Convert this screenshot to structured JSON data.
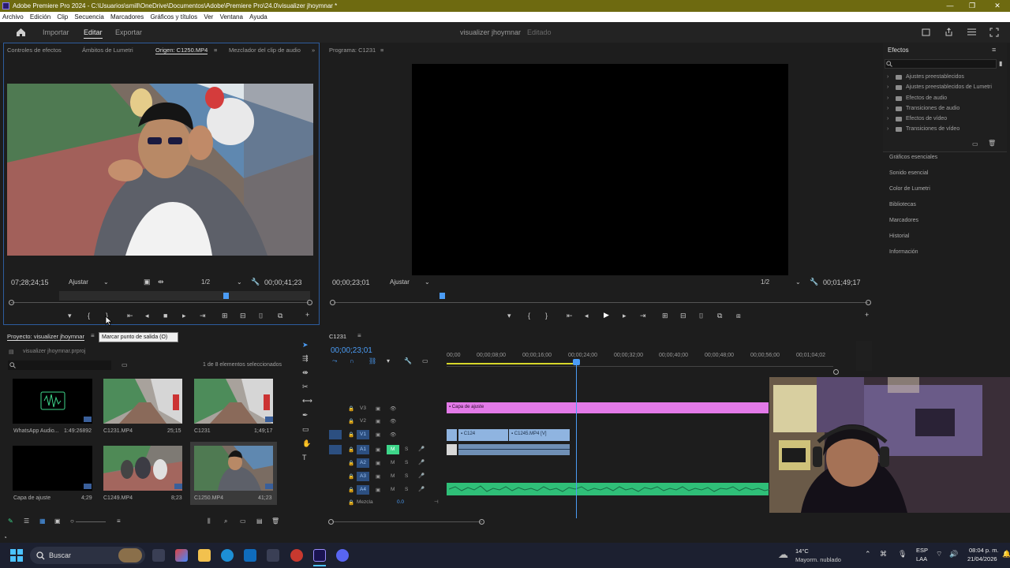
{
  "titlebar": {
    "title": "Adobe Premiere Pro 2024 - C:\\Usuarios\\smill\\OneDrive\\Documentos\\Adobe\\Premiere Pro\\24.0\\visualizer jhoymnar *",
    "minimize": "—",
    "maximize": "❐",
    "close": "✕"
  },
  "menu": [
    "Archivo",
    "Edición",
    "Clip",
    "Secuencia",
    "Marcadores",
    "Gráficos y títulos",
    "Ver",
    "Ventana",
    "Ayuda"
  ],
  "workspace": {
    "tabs": [
      "Importar",
      "Editar",
      "Exportar"
    ],
    "project_title": "visualizer jhoymnar",
    "status": "Editado"
  },
  "source_panel": {
    "tabs": [
      "Controles de efectos",
      "Ámbitos de Lumetri",
      "Origen: C1250.MP4",
      "Mezclador del clip de audio"
    ],
    "timecode": "07;28;24;15",
    "fit": "Ajustar",
    "resolution": "1/2",
    "duration": "00;00;41;23",
    "tooltip": "Marcar punto de salida (O)"
  },
  "program_panel": {
    "tab": "Programa: C1231",
    "timecode": "00;00;23;01",
    "fit": "Ajustar",
    "resolution": "1/2",
    "duration": "00;01;49;17"
  },
  "effects_panel": {
    "title": "Efectos",
    "folders": [
      "Ajustes preestablecidos",
      "Ajustes preestablecidos de Lumetri",
      "Efectos de audio",
      "Transiciones de audio",
      "Efectos de vídeo",
      "Transiciones de vídeo"
    ],
    "sections": [
      "Gráficos esenciales",
      "Sonido esencial",
      "Color de Lumetri",
      "Bibliotecas",
      "Marcadores",
      "Historial",
      "Información"
    ]
  },
  "project_panel": {
    "tab": "Proyecto: visualizer jhoymnar",
    "file": "visualizer jhoymnar.prproj",
    "selection": "1 de 8 elementos seleccionados",
    "items": [
      {
        "name": "WhatsApp Audio...",
        "duration": "1:49:26892"
      },
      {
        "name": "C1231.MP4",
        "duration": "25;15"
      },
      {
        "name": "C1231",
        "duration": "1;49;17"
      },
      {
        "name": "Capa de ajuste",
        "duration": "4;29"
      },
      {
        "name": "C1249.MP4",
        "duration": "8;23"
      },
      {
        "name": "C1250.MP4",
        "duration": "41;23"
      }
    ]
  },
  "timeline": {
    "tab": "C1231",
    "timecode": "00;00;23;01",
    "ruler": [
      "00;00",
      "00;00;08;00",
      "00;00;16;00",
      "00;00;24;00",
      "00;00;32;00",
      "00;00;40;00",
      "00;00;48;00",
      "00;00;56;00",
      "00;01;04;02"
    ],
    "tracks": [
      "V3",
      "V2",
      "V1",
      "A1",
      "A2",
      "A3",
      "A4"
    ],
    "mix_label": "Mezcla",
    "mix_value": "0.0",
    "clips": {
      "adjust": "Capa de ajuste",
      "v1a": "C124",
      "v1b": "C1245.MP4 [V]"
    },
    "solo": "S",
    "mute": "M"
  },
  "taskbar": {
    "search": "Buscar",
    "weather_temp": "14°C",
    "weather_desc": "Mayorm. nublado",
    "lang1": "ESP",
    "lang2": "LAA",
    "time": "08:04 p. m.",
    "date": "21/04/2026"
  },
  "colors": {
    "accent": "#4b9cf5",
    "adjust_clip": "#e37ae8",
    "video_clip": "#8fb4e0",
    "audio_clip": "#3ed68a"
  }
}
